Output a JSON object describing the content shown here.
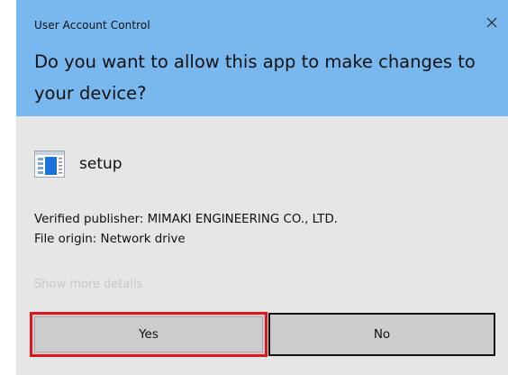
{
  "window": {
    "title": "User Account Control",
    "close_icon": "close-icon"
  },
  "prompt": {
    "question": "Do you want to allow this app to make changes to your device?"
  },
  "app": {
    "icon": "application-window-icon",
    "name": "setup"
  },
  "info": {
    "publisher": "Verified publisher: MIMAKI ENGINEERING CO., LTD.",
    "origin": "File origin: Network drive"
  },
  "details_link": "Show more details",
  "buttons": {
    "yes": "Yes",
    "no": "No"
  },
  "colors": {
    "header": "#79b8ee",
    "body": "#e6e6e6",
    "button": "#cccccc",
    "highlight": "#e0141c"
  }
}
